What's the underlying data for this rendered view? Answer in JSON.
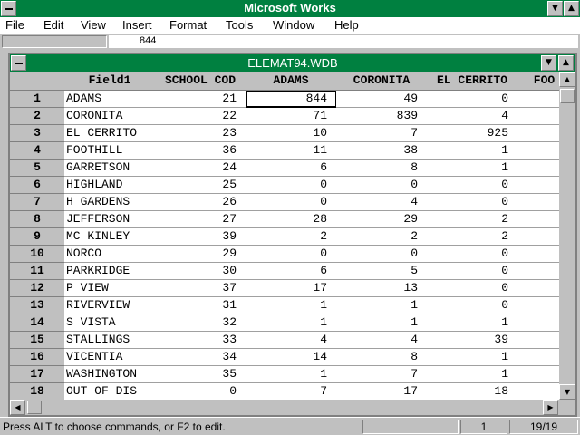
{
  "app": {
    "title": "Microsoft Works"
  },
  "menu": [
    "File",
    "Edit",
    "View",
    "Insert",
    "Format",
    "Tools",
    "Window",
    "Help"
  ],
  "formula": {
    "value": "844"
  },
  "document": {
    "title": "ELEMAT94.WDB"
  },
  "columns": [
    "Field1",
    "SCHOOL COD",
    "ADAMS",
    "CORONITA",
    "EL CERRITO",
    "FOO"
  ],
  "rows": [
    {
      "num": "1",
      "cells": [
        "ADAMS",
        "21",
        "844",
        "49",
        "0"
      ]
    },
    {
      "num": "2",
      "cells": [
        "CORONITA",
        "22",
        "71",
        "839",
        "4"
      ]
    },
    {
      "num": "3",
      "cells": [
        "EL CERRITO",
        "23",
        "10",
        "7",
        "925"
      ]
    },
    {
      "num": "4",
      "cells": [
        "FOOTHILL",
        "36",
        "11",
        "38",
        "1"
      ]
    },
    {
      "num": "5",
      "cells": [
        "GARRETSON",
        "24",
        "6",
        "8",
        "1"
      ]
    },
    {
      "num": "6",
      "cells": [
        "HIGHLAND",
        "25",
        "0",
        "0",
        "0"
      ]
    },
    {
      "num": "7",
      "cells": [
        "H GARDENS",
        "26",
        "0",
        "4",
        "0"
      ]
    },
    {
      "num": "8",
      "cells": [
        "JEFFERSON",
        "27",
        "28",
        "29",
        "2"
      ]
    },
    {
      "num": "9",
      "cells": [
        "MC KINLEY",
        "39",
        "2",
        "2",
        "2"
      ]
    },
    {
      "num": "10",
      "cells": [
        "NORCO",
        "29",
        "0",
        "0",
        "0"
      ]
    },
    {
      "num": "11",
      "cells": [
        "PARKRIDGE",
        "30",
        "6",
        "5",
        "0"
      ]
    },
    {
      "num": "12",
      "cells": [
        "P VIEW",
        "37",
        "17",
        "13",
        "0"
      ]
    },
    {
      "num": "13",
      "cells": [
        "RIVERVIEW",
        "31",
        "1",
        "1",
        "0"
      ]
    },
    {
      "num": "14",
      "cells": [
        "S VISTA",
        "32",
        "1",
        "1",
        "1"
      ]
    },
    {
      "num": "15",
      "cells": [
        "STALLINGS",
        "33",
        "4",
        "4",
        "39"
      ]
    },
    {
      "num": "16",
      "cells": [
        "VICENTIA",
        "34",
        "14",
        "8",
        "1"
      ]
    },
    {
      "num": "17",
      "cells": [
        "WASHINGTON",
        "35",
        "1",
        "7",
        "1"
      ]
    },
    {
      "num": "18",
      "cells": [
        "OUT OF DIS",
        "0",
        "7",
        "17",
        "18"
      ]
    }
  ],
  "selected": {
    "row": 0,
    "col": 2
  },
  "status": {
    "message": "Press ALT to choose commands, or F2 to edit.",
    "record": "1",
    "count": "19/19"
  },
  "icons": {
    "system_menu": "system-menu-icon",
    "minimize": "minimize-icon",
    "maximize": "maximize-icon",
    "scroll_up": "scroll-up-arrow-icon",
    "scroll_down": "scroll-down-arrow-icon",
    "scroll_left": "scroll-left-arrow-icon",
    "scroll_right": "scroll-right-arrow-icon"
  },
  "colors": {
    "titlebar": "#008040",
    "chrome": "#c0c0c0"
  }
}
